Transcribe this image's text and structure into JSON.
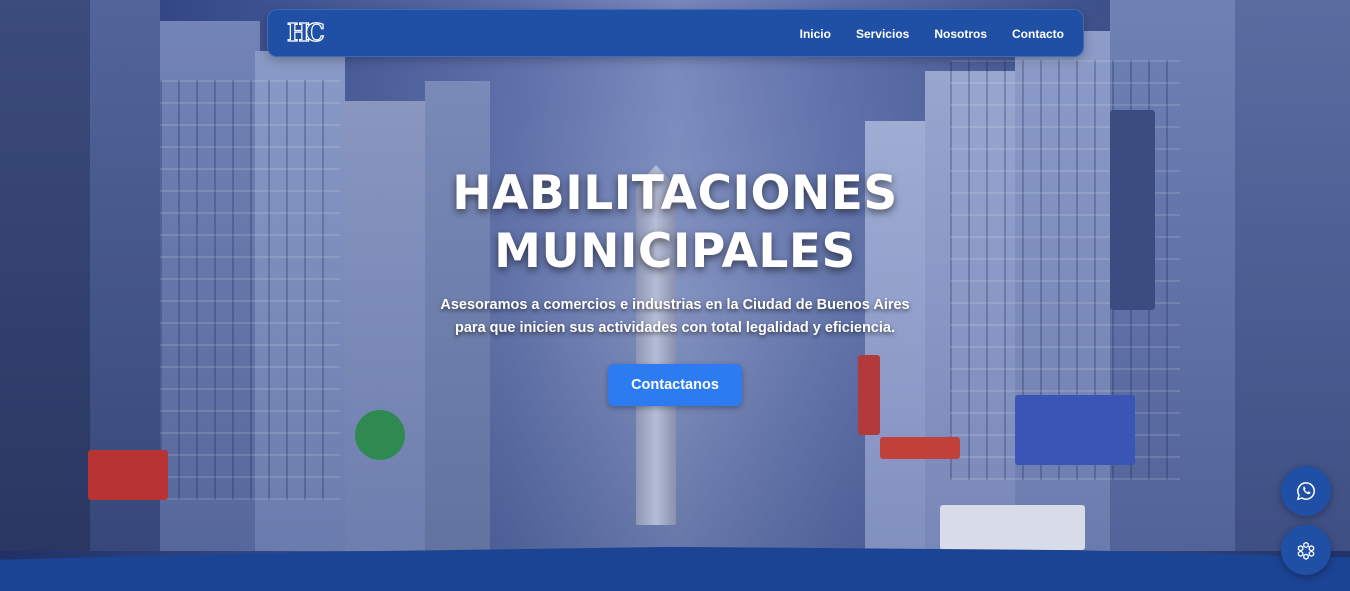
{
  "navbar": {
    "logo_text": "HC",
    "links": [
      {
        "label": "Inicio"
      },
      {
        "label": "Servicios"
      },
      {
        "label": "Nosotros"
      },
      {
        "label": "Contacto"
      }
    ]
  },
  "hero": {
    "title_line1": "HABILITACIONES",
    "title_line2": "MUNICIPALES",
    "subtitle": "Asesoramos a comercios e industrias en la Ciudad de Buenos Aires para que inicien sus actividades con total legalidad y eficiencia.",
    "cta_label": "Contactanos"
  },
  "floating_buttons": {
    "whatsapp_icon": "whatsapp-icon",
    "chat_icon": "chatbot-icon"
  },
  "colors": {
    "navbar_bg": "#1f50a6",
    "cta_bg": "#2d7bf0",
    "text": "#ffffff"
  }
}
